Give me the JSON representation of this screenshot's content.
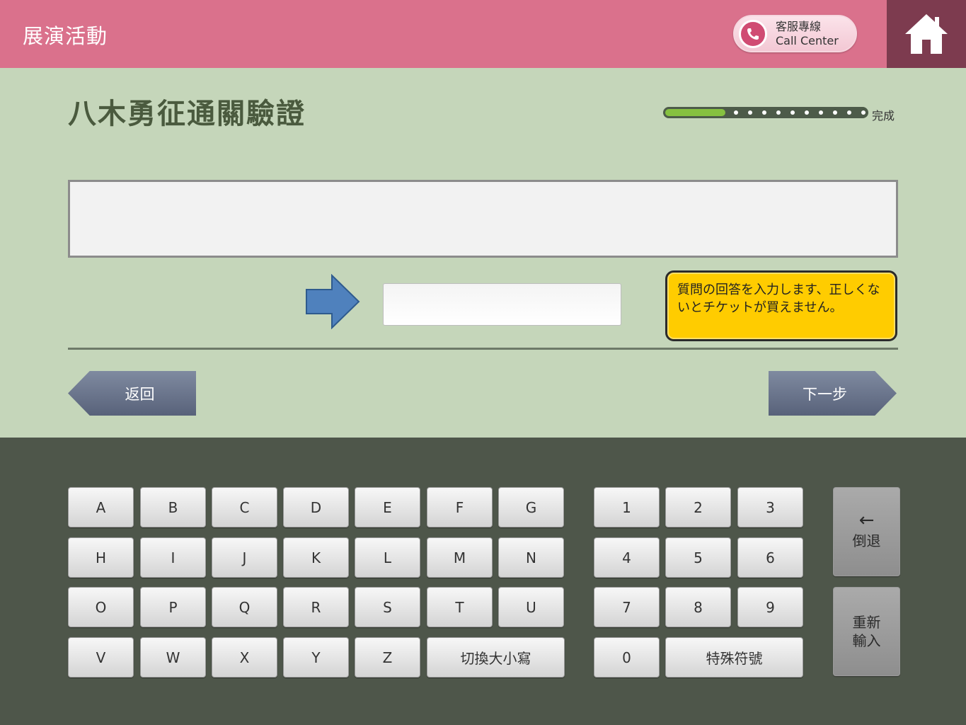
{
  "header": {
    "title": "展演活動",
    "call_line1": "客服專線",
    "call_line2": "Call Center",
    "bg_color": "#da718c",
    "home_bg_color": "#7d3b4f"
  },
  "main": {
    "title": "八木勇征通關驗證",
    "progress_label": "完成",
    "progress_fraction": 0.3,
    "question_text": "",
    "answer_value": "",
    "hint": "質問の回答を入力します、正しくないとチケットが買えません。",
    "back_label": "返回",
    "next_label": "下一步"
  },
  "keyboard": {
    "letters": [
      "A",
      "B",
      "C",
      "D",
      "E",
      "F",
      "G",
      "H",
      "I",
      "J",
      "K",
      "L",
      "M",
      "N",
      "O",
      "P",
      "Q",
      "R",
      "S",
      "T",
      "U",
      "V",
      "W",
      "X",
      "Y",
      "Z"
    ],
    "toggle_case": "切換大小寫",
    "digits": [
      "1",
      "2",
      "3",
      "4",
      "5",
      "6",
      "7",
      "8",
      "9",
      "0"
    ],
    "symbols": "特殊符號",
    "backspace_arrow": "←",
    "backspace": "倒退",
    "reset": "重新輸入"
  },
  "icons": [
    "phone-icon",
    "home-icon",
    "arrow-right-icon"
  ],
  "colors": {
    "content_bg": "#c5d6ba",
    "keyboard_bg": "#4e564a",
    "hint_bg": "#ffcc00",
    "progress_fill": "#86c140",
    "nav_button": "#6b7590"
  }
}
